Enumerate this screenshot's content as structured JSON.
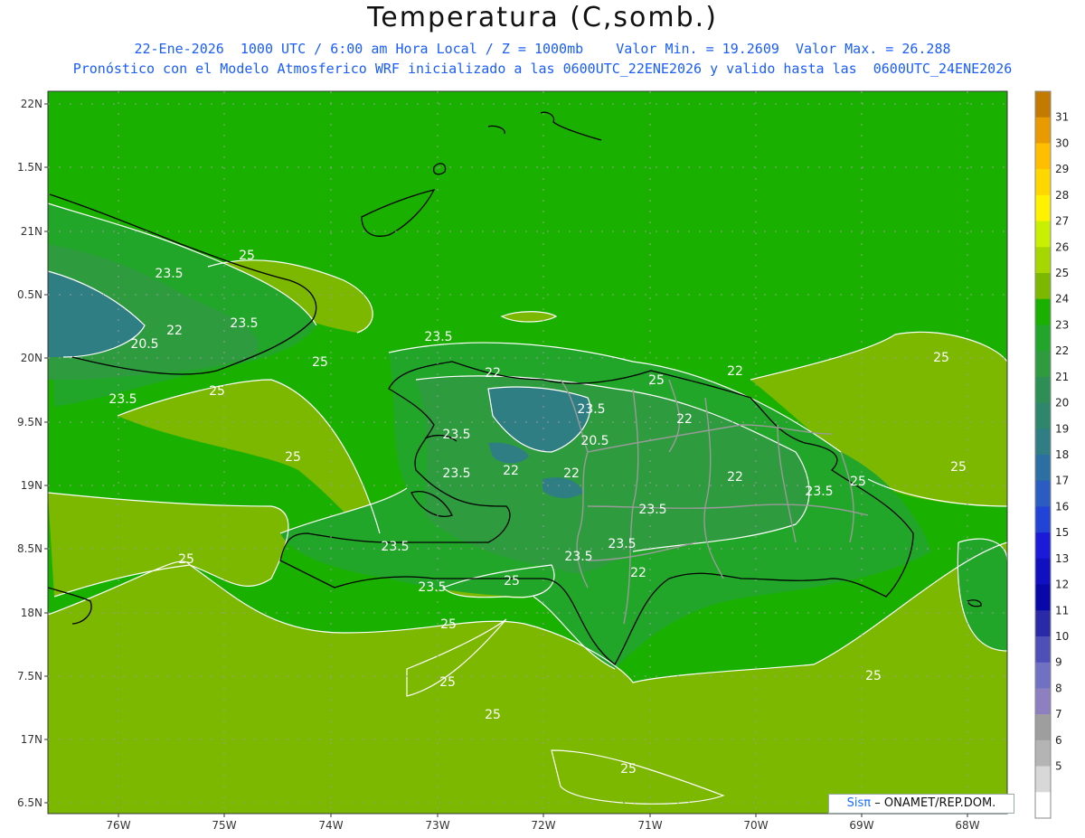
{
  "header": {
    "title": "Temperatura (C,somb.)",
    "line1": "22-Ene-2026  1000 UTC / 6:00 am Hora Local / Z = 1000mb    Valor Min. = 19.2609  Valor Max. = 26.288",
    "line2": "Pronóstico con el Modelo Atmosferico WRF inicializado a las 0600UTC_22ENE2026 y valido hasta las  0600UTC_24ENE2026"
  },
  "axes": {
    "lat_ticks": [
      "22N",
      "1.5N",
      "21N",
      "0.5N",
      "20N",
      "9.5N",
      "19N",
      "8.5N",
      "18N",
      "7.5N",
      "17N",
      "6.5N"
    ],
    "lon_ticks": [
      "76W",
      "75W",
      "74W",
      "73W",
      "72W",
      "71W",
      "70W",
      "69W",
      "68W"
    ]
  },
  "colorbar": {
    "levels": [
      "31",
      "30",
      "29",
      "28",
      "27",
      "26",
      "25",
      "24",
      "23",
      "22",
      "21",
      "20",
      "19",
      "18",
      "17",
      "16",
      "15",
      "13",
      "12",
      "11",
      "10",
      "9",
      "8",
      "7",
      "6",
      "5"
    ],
    "colors": [
      "#c47a00",
      "#e89a00",
      "#ffbf00",
      "#ffd700",
      "#fff200",
      "#c8f000",
      "#a6d800",
      "#7cb800",
      "#1ab000",
      "#22a62a",
      "#2e9c3e",
      "#2d8f55",
      "#2f876b",
      "#2f7e83",
      "#2c6fa3",
      "#2a5cc2",
      "#2244d6",
      "#1a1ad8",
      "#1010c0",
      "#0808a8",
      "#2a2aa8",
      "#4f4fb8",
      "#7171c4",
      "#8e7fc0",
      "#9e9e9e",
      "#b4b4b4",
      "#d8d8d8",
      "#ffffff"
    ]
  },
  "contour_labels": [
    "25",
    "23.5",
    "22",
    "20.5",
    "23.5",
    "25",
    "25",
    "23.5",
    "25",
    "23.5",
    "22",
    "23.5",
    "25",
    "22",
    "20.5",
    "22",
    "22",
    "23.5",
    "22",
    "23.5",
    "22",
    "23.5",
    "25",
    "25",
    "23.5",
    "25",
    "23.5",
    "25",
    "23.5",
    "23.5",
    "25",
    "25",
    "25",
    "25",
    "25",
    "23.5",
    "25",
    "22"
  ],
  "credit": {
    "brand": "Sisπ",
    "text": "– ONAMET/REP.DOM."
  }
}
